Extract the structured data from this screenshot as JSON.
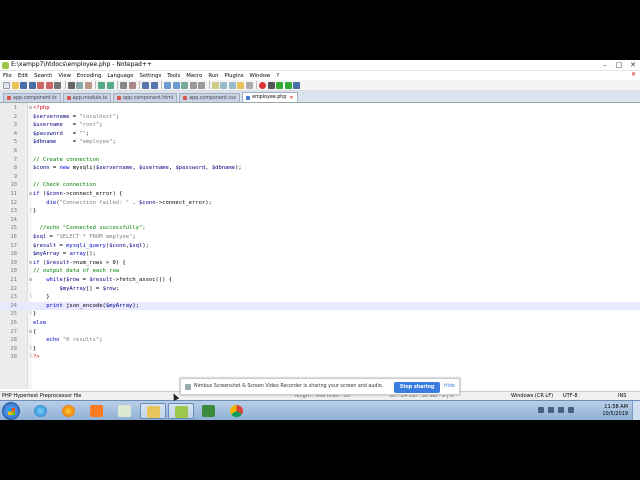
{
  "window": {
    "title": "E:\\xampp7\\htdocs\\employee.php - Notepad++",
    "controls": [
      "–",
      "□",
      "✕"
    ]
  },
  "menu": [
    "File",
    "Edit",
    "Search",
    "View",
    "Encoding",
    "Language",
    "Settings",
    "Tools",
    "Macro",
    "Run",
    "Plugins",
    "Window",
    "?"
  ],
  "menu_close": "✕",
  "tabs": [
    {
      "label": "app.component.ts",
      "active": false
    },
    {
      "label": "app.module.ts",
      "active": false
    },
    {
      "label": "app.component.html",
      "active": false
    },
    {
      "label": "app.component.css",
      "active": false
    },
    {
      "label": "employee.php",
      "active": true
    }
  ],
  "editor": {
    "highlighted_line": 24,
    "lines": [
      {
        "n": "1",
        "fold": "⊟",
        "parts": [
          [
            "tag",
            "<?php"
          ]
        ]
      },
      {
        "n": "2",
        "parts": [
          [
            "var",
            "$servername"
          ],
          [
            "op",
            " = "
          ],
          [
            "str",
            "\"localhost\""
          ],
          [
            "op",
            ";"
          ]
        ]
      },
      {
        "n": "3",
        "parts": [
          [
            "var",
            "$username"
          ],
          [
            "op",
            "   = "
          ],
          [
            "str",
            "\"root\""
          ],
          [
            "op",
            ";"
          ]
        ]
      },
      {
        "n": "4",
        "parts": [
          [
            "var",
            "$password"
          ],
          [
            "op",
            "   = "
          ],
          [
            "str",
            "\"\""
          ],
          [
            "op",
            ";"
          ]
        ]
      },
      {
        "n": "5",
        "parts": [
          [
            "var",
            "$dbname"
          ],
          [
            "op",
            "     = "
          ],
          [
            "str",
            "\"employee\""
          ],
          [
            "op",
            ";"
          ]
        ]
      },
      {
        "n": "6",
        "parts": []
      },
      {
        "n": "7",
        "parts": [
          [
            "cmt",
            "// Create connection"
          ]
        ]
      },
      {
        "n": "8",
        "parts": [
          [
            "var",
            "$conn"
          ],
          [
            "op",
            " = "
          ],
          [
            "kw",
            "new"
          ],
          [
            "op",
            " mysqli("
          ],
          [
            "var",
            "$servername"
          ],
          [
            "op",
            ", "
          ],
          [
            "var",
            "$username"
          ],
          [
            "op",
            ", "
          ],
          [
            "var",
            "$password"
          ],
          [
            "op",
            ", "
          ],
          [
            "var",
            "$dbname"
          ],
          [
            "op",
            ");"
          ]
        ]
      },
      {
        "n": "9",
        "parts": []
      },
      {
        "n": "10",
        "parts": [
          [
            "cmt",
            "// Check connection"
          ]
        ]
      },
      {
        "n": "11",
        "fold": "⊟",
        "parts": [
          [
            "kw",
            "if"
          ],
          [
            "op",
            " ("
          ],
          [
            "var",
            "$conn"
          ],
          [
            "op",
            "->connect_error) {"
          ]
        ]
      },
      {
        "n": "12",
        "parts": [
          [
            "op",
            "    "
          ],
          [
            "kw",
            "die"
          ],
          [
            "op",
            "("
          ],
          [
            "str",
            "\"Connection failed: \""
          ],
          [
            "op",
            " . "
          ],
          [
            "var",
            "$conn"
          ],
          [
            "op",
            "->connect_error);"
          ]
        ]
      },
      {
        "n": "13",
        "fold": "└",
        "parts": [
          [
            "op",
            "}"
          ]
        ]
      },
      {
        "n": "14",
        "parts": []
      },
      {
        "n": "15",
        "parts": [
          [
            "op",
            "  "
          ],
          [
            "cmt",
            "//echo \"Connected successfully\";"
          ]
        ]
      },
      {
        "n": "16",
        "parts": [
          [
            "var",
            "$sql"
          ],
          [
            "op",
            " = "
          ],
          [
            "str",
            "\"SELECT * FROM emplyee\""
          ],
          [
            "op",
            ";"
          ]
        ]
      },
      {
        "n": "17",
        "parts": [
          [
            "var",
            "$result"
          ],
          [
            "op",
            " = "
          ],
          [
            "kw",
            "mysqli_query"
          ],
          [
            "op",
            "("
          ],
          [
            "var",
            "$conn"
          ],
          [
            "op",
            ","
          ],
          [
            "var",
            "$sql"
          ],
          [
            "op",
            ");"
          ]
        ]
      },
      {
        "n": "18",
        "parts": [
          [
            "var",
            "$myArray"
          ],
          [
            "op",
            " = "
          ],
          [
            "kw",
            "array"
          ],
          [
            "op",
            "();"
          ]
        ]
      },
      {
        "n": "19",
        "fold": "⊟",
        "parts": [
          [
            "kw",
            "if"
          ],
          [
            "op",
            " ("
          ],
          [
            "var",
            "$result"
          ],
          [
            "op",
            "->num_rows > 0) {"
          ]
        ]
      },
      {
        "n": "20",
        "parts": [
          [
            "cmt",
            "// output data of each row"
          ]
        ]
      },
      {
        "n": "21",
        "fold": "⊟",
        "parts": [
          [
            "op",
            "    "
          ],
          [
            "kw",
            "while"
          ],
          [
            "op",
            "("
          ],
          [
            "var",
            "$row"
          ],
          [
            "op",
            " = "
          ],
          [
            "var",
            "$result"
          ],
          [
            "op",
            "->fetch_assoc()) {"
          ]
        ]
      },
      {
        "n": "22",
        "parts": [
          [
            "op",
            "        "
          ],
          [
            "var",
            "$myArray"
          ],
          [
            "op",
            "[] = "
          ],
          [
            "var",
            "$row"
          ],
          [
            "op",
            ";"
          ]
        ]
      },
      {
        "n": "23",
        "fold": "└",
        "parts": [
          [
            "op",
            "    }"
          ]
        ]
      },
      {
        "n": "24",
        "parts": [
          [
            "op",
            "    "
          ],
          [
            "kw",
            "print"
          ],
          [
            "op",
            " json_encode("
          ],
          [
            "var",
            "$myArray"
          ],
          [
            "op",
            ");"
          ]
        ]
      },
      {
        "n": "25",
        "fold": "└",
        "parts": [
          [
            "op",
            "}"
          ]
        ]
      },
      {
        "n": "26",
        "parts": [
          [
            "kw",
            "else"
          ]
        ]
      },
      {
        "n": "27",
        "fold": "⊟",
        "parts": [
          [
            "op",
            "{"
          ]
        ]
      },
      {
        "n": "28",
        "parts": [
          [
            "op",
            "    "
          ],
          [
            "kw",
            "echo"
          ],
          [
            "op",
            " "
          ],
          [
            "str",
            "\"0 results\""
          ],
          [
            "op",
            ";"
          ]
        ]
      },
      {
        "n": "29",
        "fold": "└",
        "parts": [
          [
            "op",
            "}"
          ]
        ]
      },
      {
        "n": "30",
        "fold": "└",
        "parts": [
          [
            "tag",
            "?>"
          ]
        ]
      }
    ]
  },
  "status": {
    "language": "PHP Hypertext Preprocessor file",
    "length": "length : 649    lines : 30",
    "position": "Ln : 24    Col : 30    Sel : 0 | 0",
    "eol": "Windows (CR LF)",
    "encoding": "UTF-8",
    "mode": "INS"
  },
  "nimbus": {
    "text": "Nimbus Screenshot & Screen Video Recorder is sharing your screen and audio.",
    "stop_label": "Stop sharing",
    "hide_label": "Hide"
  },
  "taskbar": {
    "apps": [
      "ie-icon",
      "firefox-icon",
      "xampp-icon",
      "chrome-apps-icon",
      "explorer-icon",
      "notepadpp-icon",
      "camtasia-icon",
      "chrome-icon"
    ],
    "time": "11:58 AM",
    "date": "10/5/2019"
  }
}
